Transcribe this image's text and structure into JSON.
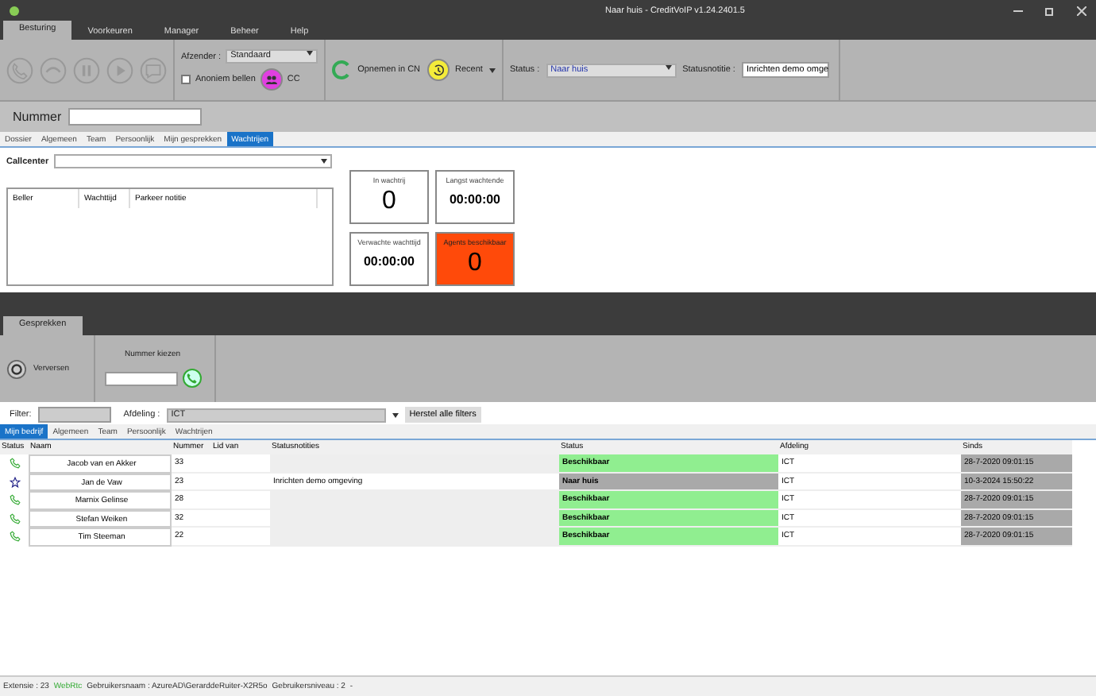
{
  "window": {
    "title": "Naar huis - CreditVoIP v1.24.2401.5"
  },
  "ribbon": {
    "tabs": [
      {
        "label": "Besturing",
        "selected": true
      },
      {
        "label": "Voorkeuren",
        "selected": false
      },
      {
        "label": "Manager",
        "selected": false
      },
      {
        "label": "Beheer",
        "selected": false
      },
      {
        "label": "Help",
        "selected": false
      }
    ],
    "afzender_label": "Afzender :",
    "afzender_value": "Standaard",
    "anoniem": {
      "label": "Anoniem bellen",
      "checked": false
    },
    "cc": "CC",
    "opnemen": "Opnemen in CN",
    "recent": "Recent",
    "status_label": "Status :",
    "status_value": "Naar huis",
    "statusnotitie_label": "Statusnotitie :",
    "statusnotitie_value": "Inrichten demo omge"
  },
  "nummer": {
    "label": "Nummer"
  },
  "subtabs": [
    {
      "label": "Dossier",
      "selected": false
    },
    {
      "label": "Algemeen",
      "selected": false
    },
    {
      "label": "Team",
      "selected": false
    },
    {
      "label": "Persoonlijk",
      "selected": false
    },
    {
      "label": "Mijn gesprekken",
      "selected": false
    },
    {
      "label": "Wachtrijen",
      "selected": true
    }
  ],
  "callcenter": {
    "label": "Callcenter",
    "columns": [
      "Beller",
      "Wachttijd",
      "Parkeer notitie"
    ]
  },
  "tiles": [
    {
      "label": "In wachtrij",
      "value": "0",
      "kind": "count",
      "alert": false
    },
    {
      "label": "Langst wachtende",
      "value": "00:00:00",
      "kind": "time",
      "alert": false
    },
    {
      "label": "Verwachte wachttijd",
      "value": "00:00:00",
      "kind": "time",
      "alert": false
    },
    {
      "label": "Agents beschikbaar",
      "value": "0",
      "kind": "count",
      "alert": true
    }
  ],
  "conversations": {
    "tab": "Gesprekken",
    "refresh": "Verversen",
    "dial_label": "Nummer kiezen"
  },
  "filter": {
    "label": "Filter:",
    "afdeling_label": "Afdeling :",
    "afdeling_value": "ICT",
    "reset": "Herstel alle filters"
  },
  "list_tabs": [
    {
      "label": "Mijn bedrijf",
      "selected": true
    },
    {
      "label": "Algemeen",
      "selected": false
    },
    {
      "label": "Team",
      "selected": false
    },
    {
      "label": "Persoonlijk",
      "selected": false
    },
    {
      "label": "Wachtrijen",
      "selected": false
    }
  ],
  "table": {
    "columns": [
      "Status",
      "Naam",
      "Nummer",
      "Lid van",
      "Statusnotities",
      "Status",
      "Afdeling",
      "Sinds"
    ],
    "rows": [
      {
        "kind": "phone",
        "name": "Jacob van en Akker",
        "number": "33",
        "note": "",
        "status": "Beschikbaar",
        "available": true,
        "department": "ICT",
        "since": "28-7-2020 09:01:15"
      },
      {
        "kind": "star",
        "name": "Jan de Vaw",
        "number": "23",
        "note": "Inrichten demo omgeving",
        "status": "Naar huis",
        "available": false,
        "department": "ICT",
        "since": "10-3-2024 15:50:22"
      },
      {
        "kind": "phone",
        "name": "Marnix Gelinse",
        "number": "28",
        "note": "",
        "status": "Beschikbaar",
        "available": true,
        "department": "ICT",
        "since": "28-7-2020 09:01:15"
      },
      {
        "kind": "phone",
        "name": "Stefan Weiken",
        "number": "32",
        "note": "",
        "status": "Beschikbaar",
        "available": true,
        "department": "ICT",
        "since": "28-7-2020 09:01:15"
      },
      {
        "kind": "phone",
        "name": "Tim Steeman",
        "number": "22",
        "note": "",
        "status": "Beschikbaar",
        "available": true,
        "department": "ICT",
        "since": "28-7-2020 09:01:15"
      }
    ]
  },
  "status_bar": {
    "extensie": "Extensie : 23",
    "webrtc": "WebRtc",
    "gebruikersnaam": "Gebruikersnaam : AzureAD\\GerarddeRuiter-X2R5o",
    "niveau": "Gebruikersniveau : 2",
    "dash": "-"
  }
}
